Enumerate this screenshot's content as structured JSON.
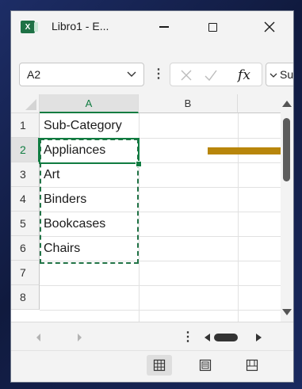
{
  "window": {
    "title": "Libro1 - E...",
    "icon_letter": "X"
  },
  "formula_bar": {
    "name_box": "A2",
    "fx_label": "fx",
    "expand_text": "Su"
  },
  "sheet": {
    "columns": [
      "A",
      "B"
    ],
    "row_numbers": [
      "1",
      "2",
      "3",
      "4",
      "5",
      "6",
      "7",
      "8"
    ],
    "cells_a": [
      "Sub-Category",
      "Appliances",
      "Art",
      "Binders",
      "Bookcases",
      "Chairs",
      "",
      ""
    ],
    "active_cell": "A2"
  },
  "colors": {
    "excel_green": "#107c41",
    "marquee": "#217346",
    "arrow": "#b8860b",
    "desktop": "#16224a"
  },
  "icons": {
    "app": "excel-icon",
    "minimize": "minimize-icon",
    "maximize": "maximize-icon",
    "close": "close-icon",
    "name_box_dropdown": "chevron-down-icon",
    "cancel": "x-icon",
    "enter": "check-icon",
    "function": "fx-icon",
    "normal_view": "grid-view-icon",
    "page_layout": "page-layout-icon",
    "page_break": "page-break-icon"
  }
}
